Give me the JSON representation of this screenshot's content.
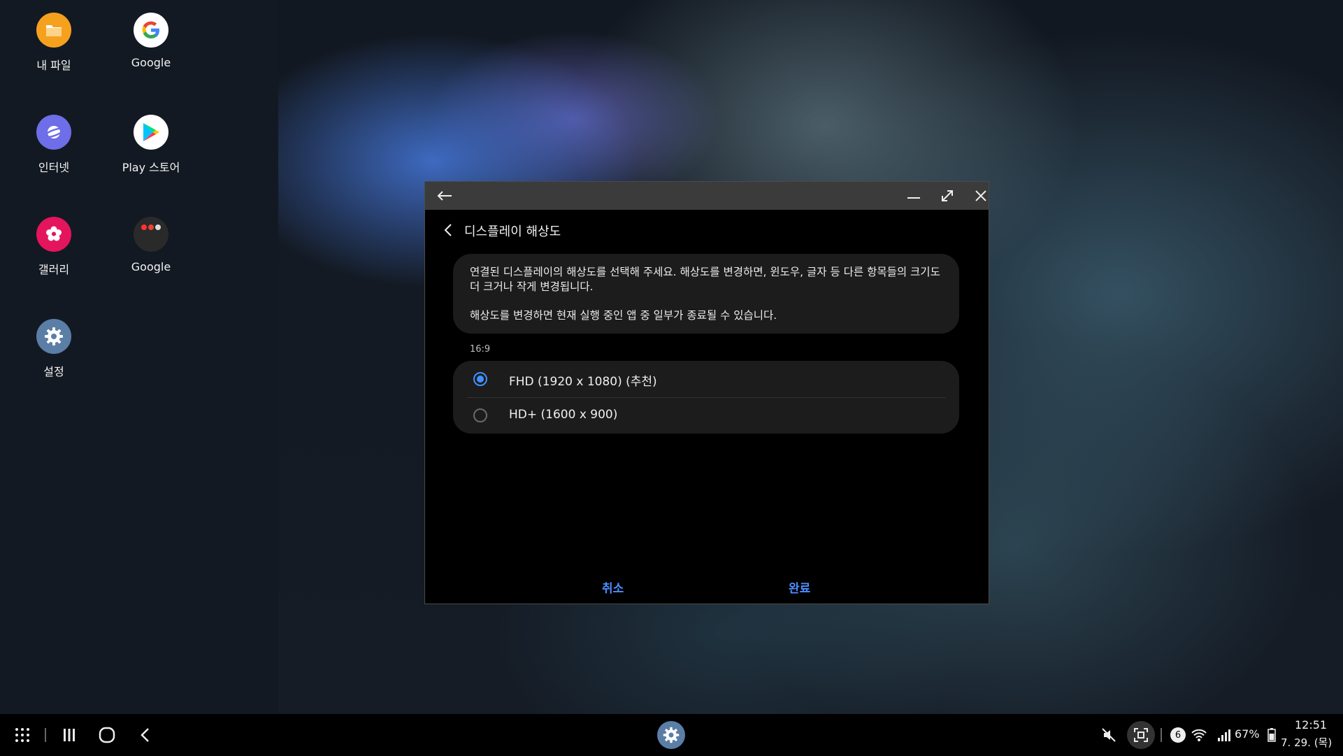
{
  "desktop": {
    "icons": [
      {
        "label": "내 파일",
        "icon": "folder-icon",
        "color": "#f6a11e"
      },
      {
        "label": "Google",
        "icon": "google-icon",
        "color": "#ffffff"
      },
      {
        "label": "인터넷",
        "icon": "internet-planet-icon",
        "color": "#6d6ee8"
      },
      {
        "label": "Play 스토어",
        "icon": "play-store-icon",
        "color": "#ffffff"
      },
      {
        "label": "갤러리",
        "icon": "gallery-flower-icon",
        "color": "#e4145d"
      },
      {
        "label": "Google",
        "icon": "google-folder-icon",
        "color": "#2a2a2a"
      },
      {
        "label": "설정",
        "icon": "settings-gear-icon",
        "color": "#5b7ea6"
      }
    ]
  },
  "window": {
    "page_title": "디스플레이 해상도",
    "info_line1": "연결된 디스플레이의 해상도를 선택해 주세요. 해상도를 변경하면, 윈도우, 글자 등 다른 항목들의 크기도 더 크거나 작게 변경됩니다.",
    "info_line2": "해상도를 변경하면 현재 실행 중인 앱 중 일부가 종료될 수 있습니다.",
    "aspect_label": "16:9",
    "options": [
      {
        "label": "FHD (1920 x 1080) (추천)",
        "selected": true
      },
      {
        "label": "HD+ (1600 x 900)",
        "selected": false
      }
    ],
    "cancel_label": "취소",
    "done_label": "완료",
    "accent_color": "#3e91ff"
  },
  "taskbar": {
    "battery": "67%",
    "notification_count": "6",
    "time": "12:51",
    "date": "7. 29. (목)"
  }
}
